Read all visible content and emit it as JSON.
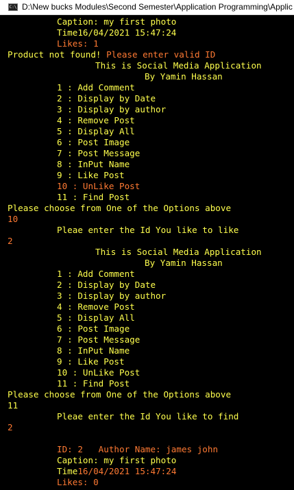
{
  "window": {
    "title": "D:\\New bucks Modules\\Second Semester\\Application Programming\\Applic",
    "icon_text": "C:\\",
    "icon": "console-app-icon"
  },
  "colors": {
    "background": "#000000",
    "text_yellow": "#ffff4d",
    "text_orange": "#ff7a33"
  },
  "console": {
    "caption_1": "Caption: my first photo",
    "time_1": "Time16/04/2021 15:47:24",
    "likes_1": "Likes: 1",
    "error_prefix": "Product not found!",
    "error_suffix": " Please enter valid ID",
    "menu_1": {
      "title": "This is Social Media Application",
      "author": "By Yamin Hassan",
      "items": [
        "1 : Add Comment",
        "2 : Display by Date",
        "3 : Display by author",
        "4 : Remove Post",
        "5 : Display All",
        "6 : Post Image",
        "7 : Post Message",
        "8 : InPut Name",
        "9 : Like Post",
        "10 : UnLike Post",
        "11 : Find Post"
      ]
    },
    "prompt_1": "Please choose from One of the Options above",
    "input_1": "10",
    "like_prompt": "Pleae enter the Id You like to like",
    "input_2": "2",
    "menu_2": {
      "title": "This is Social Media Application",
      "author": "By Yamin Hassan",
      "items": [
        "1 : Add Comment",
        "2 : Display by Date",
        "3 : Display by author",
        "4 : Remove Post",
        "5 : Display All",
        "6 : Post Image",
        "7 : Post Message",
        "8 : InPut Name",
        "9 : Like Post",
        "10 : UnLike Post",
        "11 : Find Post"
      ]
    },
    "prompt_2": "Please choose from One of the Options above",
    "input_3": "11",
    "find_prompt": "Pleae enter the Id You like to find",
    "input_4": "2",
    "result": {
      "id_line": "ID: 2   Author Name: james john",
      "caption": "Caption: my first photo",
      "time_label": "Time",
      "time_value": "16/04/2021 15:47:24",
      "likes": "Likes: 0"
    }
  }
}
